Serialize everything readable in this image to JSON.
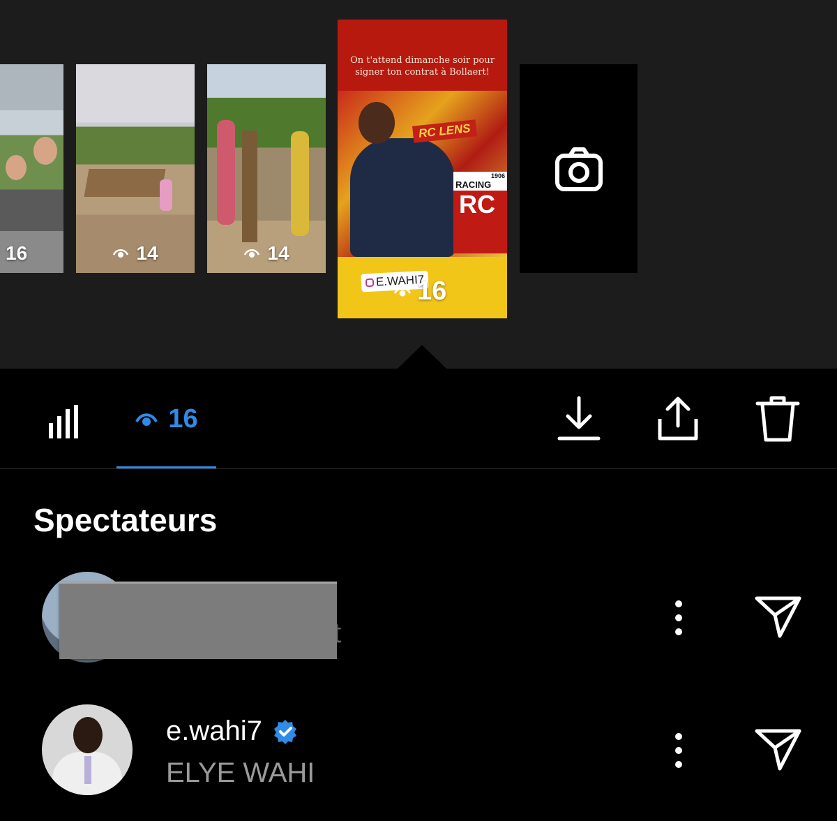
{
  "story_strip": {
    "thumbnails": [
      {
        "view_count": "16"
      },
      {
        "view_count": "14"
      },
      {
        "view_count": "14"
      }
    ],
    "active_story": {
      "caption": "On t'attend dimanche soir pour signer ton contrat à Bollaert!",
      "banner_text": "RC LENS",
      "club_text": "RACING CLUB",
      "club_year": "1906",
      "club_initials": "RC",
      "mention_tag": "E.WAHI7",
      "view_count": "16"
    },
    "camera_button": {
      "icon": "camera-icon"
    }
  },
  "toolbar": {
    "stats_tab": {
      "icon": "bar-chart-icon"
    },
    "viewers_tab": {
      "icon": "eye-icon",
      "count": "16",
      "color": "#2f8be6"
    },
    "actions": [
      {
        "name": "download",
        "icon": "download-icon"
      },
      {
        "name": "share",
        "icon": "share-icon"
      },
      {
        "name": "delete",
        "icon": "trash-icon"
      }
    ]
  },
  "viewers": {
    "heading": "Spectateurs",
    "list": [
      {
        "username": "",
        "redacted": true,
        "partial_text": "t"
      },
      {
        "username": "e.wahi7",
        "verified": true,
        "full_name": "ELYE WAHI"
      }
    ]
  },
  "colors": {
    "accent": "#2f8be6",
    "background": "#000000",
    "strip_background": "#1c1c1c",
    "secondary_text": "#9a9a9a"
  }
}
